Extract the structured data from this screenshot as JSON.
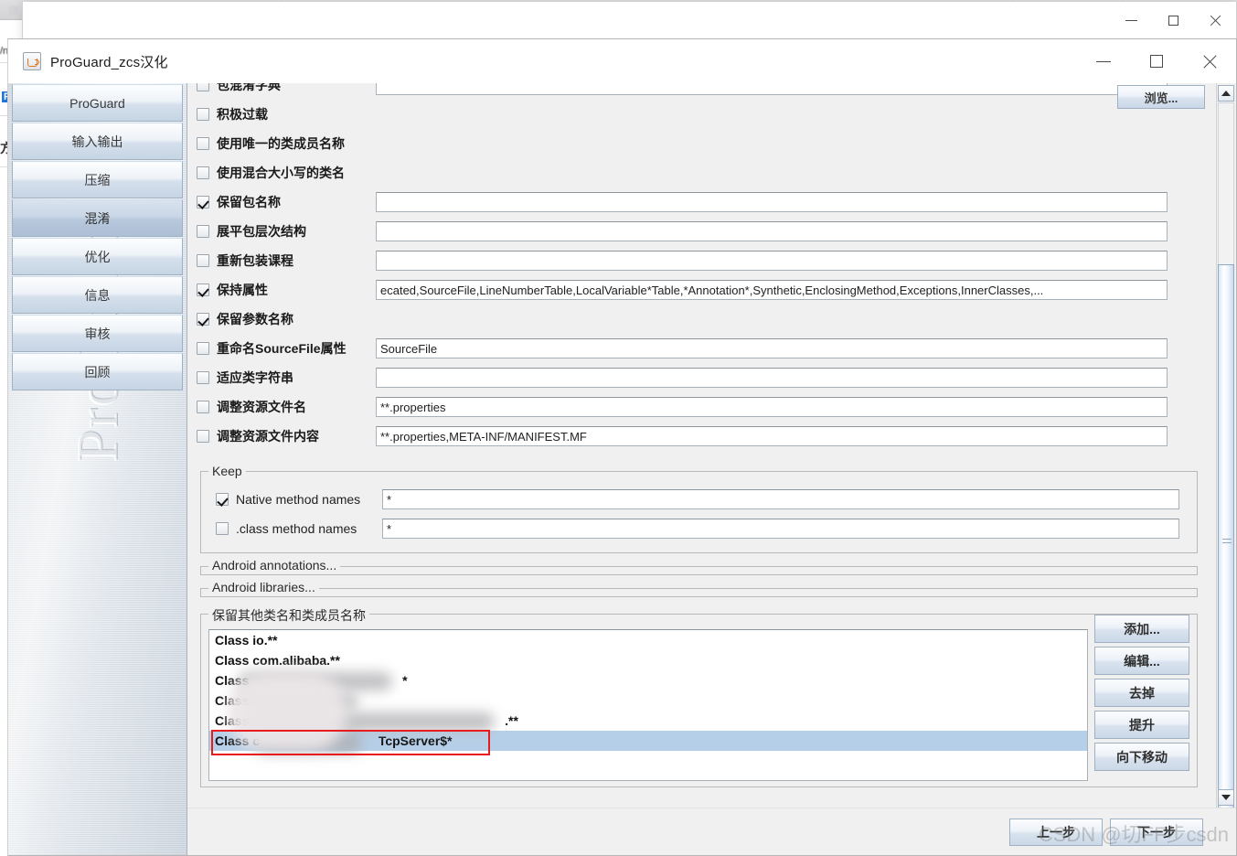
{
  "background": {
    "browser_tabs": [
      "",
      "",
      "",
      "",
      "",
      "",
      "",
      ""
    ],
    "side_labels": [
      "/n",
      "F",
      "方,"
    ]
  },
  "outer_window": {
    "controls": {
      "minimize": "minimize-icon",
      "maximize": "maximize-icon",
      "close": "close-icon"
    }
  },
  "app": {
    "title": "ProGuard_zcs汉化",
    "icon": "java-coffee-icon",
    "controls": {
      "minimize": "minimize-icon",
      "maximize": "maximize-icon",
      "close": "close-icon"
    },
    "watermark_vertical": "ProGuard"
  },
  "sidebar": {
    "items": [
      {
        "label": "ProGuard",
        "active": false
      },
      {
        "label": "输入输出",
        "active": false
      },
      {
        "label": "压缩",
        "active": false
      },
      {
        "label": "混淆",
        "active": true
      },
      {
        "label": "优化",
        "active": false
      },
      {
        "label": "信息",
        "active": false
      },
      {
        "label": "审核",
        "active": false
      },
      {
        "label": "回顾",
        "active": false
      }
    ]
  },
  "main": {
    "browse_button": "浏览...",
    "options": [
      {
        "label": "包混淆字典",
        "checked": false,
        "has_field": true,
        "value": "",
        "clipped_top": true
      },
      {
        "label": "积极过载",
        "checked": false,
        "has_field": false,
        "value": ""
      },
      {
        "label": "使用唯一的类成员名称",
        "checked": false,
        "has_field": false,
        "value": ""
      },
      {
        "label": "使用混合大小写的类名",
        "checked": false,
        "has_field": false,
        "value": ""
      },
      {
        "label": "保留包名称",
        "checked": true,
        "has_field": true,
        "value": ""
      },
      {
        "label": "展平包层次结构",
        "checked": false,
        "has_field": true,
        "value": ""
      },
      {
        "label": "重新包装课程",
        "checked": false,
        "has_field": true,
        "value": ""
      },
      {
        "label": "保持属性",
        "checked": true,
        "has_field": true,
        "value": "ecated,SourceFile,LineNumberTable,LocalVariable*Table,*Annotation*,Synthetic,EnclosingMethod,Exceptions,InnerClasses,..."
      },
      {
        "label": "保留参数名称",
        "checked": true,
        "has_field": false,
        "value": ""
      },
      {
        "label": "重命名SourceFile属性",
        "checked": false,
        "has_field": true,
        "value": "SourceFile"
      },
      {
        "label": "适应类字符串",
        "checked": false,
        "has_field": true,
        "value": ""
      },
      {
        "label": "调整资源文件名",
        "checked": false,
        "has_field": true,
        "value": "**.properties"
      },
      {
        "label": "调整资源文件内容",
        "checked": false,
        "has_field": true,
        "value": "**.properties,META-INF/MANIFEST.MF"
      }
    ],
    "keep_group": {
      "legend": "Keep",
      "rows": [
        {
          "label": "Native method names",
          "checked": true,
          "value": "*"
        },
        {
          "label": ".class method names",
          "checked": false,
          "value": "*"
        }
      ]
    },
    "android_annotations_group": {
      "legend": "Android annotations..."
    },
    "android_libraries_group": {
      "legend": "Android libraries..."
    },
    "keep_other_group": {
      "legend": "保留其他类名和类成员名称",
      "items": [
        {
          "text": "Class io.**",
          "selected": false,
          "redacted": false
        },
        {
          "text": "Class com.alibaba.**",
          "selected": false,
          "redacted": false
        },
        {
          "text": "Class",
          "selected": false,
          "redacted": true,
          "suffix": "*"
        },
        {
          "text": "Class",
          "selected": false,
          "redacted": true,
          "suffix": ""
        },
        {
          "text": "Class",
          "selected": false,
          "redacted": true,
          "suffix": ".**"
        },
        {
          "text": "Class c",
          "selected": true,
          "redacted": true,
          "suffix": "TcpServer$*"
        }
      ],
      "buttons": [
        "添加...",
        "编辑...",
        "去掉",
        "提升",
        "向下移动"
      ]
    }
  },
  "bottom": {
    "prev_button": "上一步",
    "next_button": "下一步",
    "watermark": "CSDN @切FF步csdn"
  },
  "scrollbar": {
    "up_arrow": "chevron-up-icon",
    "down_arrow": "chevron-down-icon",
    "thumb_top_pct": 24,
    "thumb_height_pct": 72
  },
  "colors": {
    "selection": "#b6cfe8",
    "highlight_box": "#e81c1c",
    "panel": "#f0f0f0",
    "accent": "#9fb0c3"
  }
}
